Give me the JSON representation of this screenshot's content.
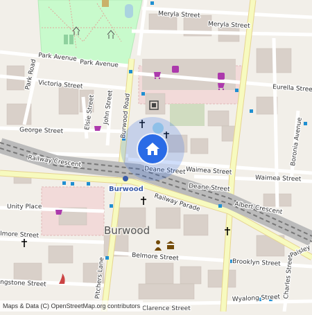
{
  "map": {
    "streets": {
      "meryla_street_1": "Meryla Street",
      "meryla_street_2": "Meryla Street",
      "park_avenue_1": "Park Avenue",
      "park_avenue_2": "Park Avenue",
      "park_road": "Park Road",
      "victoria_street": "Victoria Street",
      "eurella_street": "Eurella Street",
      "elsie_street": "Elsie Street",
      "john_street": "John Street",
      "burwood_road": "Burwood Road",
      "george_street": "George Street",
      "railway_crescent": "Railway Crescent",
      "deane_street_1": "Deane Street",
      "deane_street_2": "Deane Street",
      "waimea_street_1": "Waimea Street",
      "waimea_street_2": "Waimea Street",
      "boronia_avenue": "Boronia Avenue",
      "railway_parade": "Railway Parade",
      "albert_crescent": "Albert Crescent",
      "unity_place": "Unity Place",
      "belmore_street_1": "lmore Street",
      "belmore_street_2": "Belmore Street",
      "brooklyn_street": "Brooklyn Street",
      "pitchers_lane": "Pitchers Lane",
      "ngstone_street": "ngstone Street",
      "charles_street": "Charles Street",
      "wyalong_street": "Wyalong Street",
      "clarence_street": "Clarence Street",
      "paisley": "Paisley"
    },
    "station_label": "Burwood",
    "suburb_label": "Burwood",
    "icons": [
      "shop-icon",
      "church-icon",
      "cinema-icon",
      "bus-stop-icon",
      "courthouse-icon",
      "fire-station-icon",
      "playground-icon",
      "home-icon"
    ],
    "colors": {
      "background": "#f2efe9",
      "park": "#c8facc",
      "building": "#d9d0c9",
      "road_minor": "#ffffff",
      "road_major": "#f7fabf",
      "rail": "#999999",
      "commercial": "#f2dad9",
      "accent": "#2a6be6"
    }
  },
  "attribution": "Maps & Data (C) OpenStreetMap.org contributors"
}
